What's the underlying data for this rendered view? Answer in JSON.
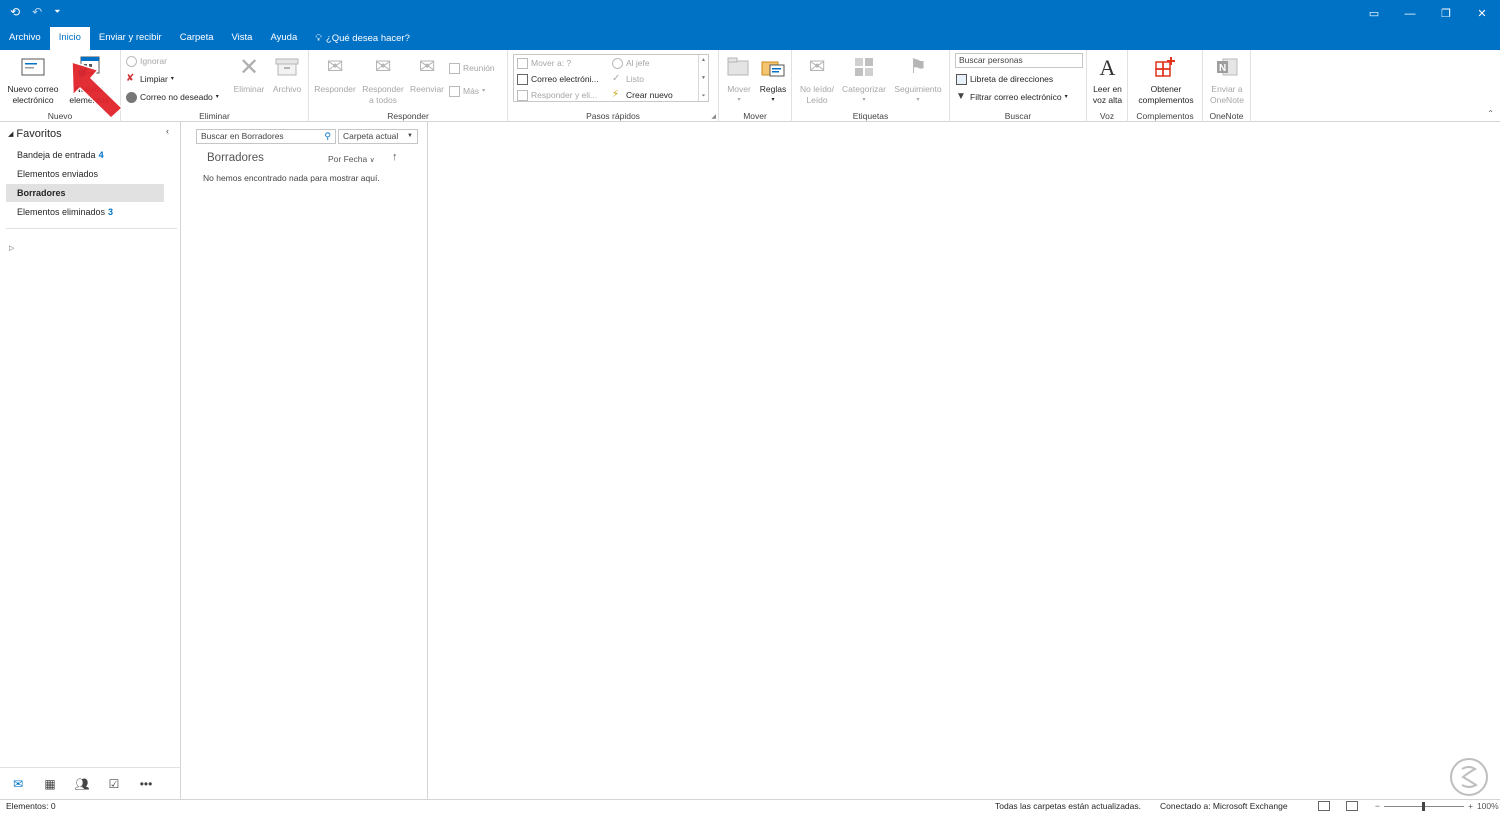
{
  "menubar": {
    "tabs": [
      "Archivo",
      "Inicio",
      "Enviar y recibir",
      "Carpeta",
      "Vista",
      "Ayuda"
    ],
    "tell_me": "¿Qué desea hacer?"
  },
  "ribbon": {
    "nuevo": {
      "new_email_1": "Nuevo correo",
      "new_email_2": "electrónico",
      "new_items_1": "Nuevos",
      "new_items_2": "elementos",
      "label": "Nuevo"
    },
    "eliminar": {
      "ignore": "Ignorar",
      "cleanup": "Limpiar",
      "junk": "Correo no deseado",
      "delete": "Eliminar",
      "archive": "Archivo",
      "label": "Eliminar"
    },
    "responder": {
      "reply": "Responder",
      "reply_all_1": "Responder",
      "reply_all_2": "a todos",
      "forward": "Reenviar",
      "meeting": "Reunión",
      "more": "Más",
      "label": "Responder"
    },
    "pasos": {
      "move_to": "Mover a: ?",
      "email": "Correo electróni...",
      "reply_delete": "Responder y eli...",
      "to_boss": "Al jefe",
      "done": "Listo",
      "create_new": "Crear nuevo",
      "label": "Pasos rápidos"
    },
    "mover": {
      "move": "Mover",
      "rules": "Reglas",
      "label": "Mover"
    },
    "etiquetas": {
      "unread_1": "No leído/",
      "unread_2": "Leído",
      "categorize": "Categorizar",
      "followup": "Seguimiento",
      "label": "Etiquetas"
    },
    "buscar": {
      "search_people": "Buscar personas",
      "address_book": "Libreta de direcciones",
      "filter": "Filtrar correo electrónico",
      "label": "Buscar"
    },
    "voz": {
      "read_1": "Leer en",
      "read_2": "voz alta",
      "label": "Voz"
    },
    "complementos": {
      "get_1": "Obtener",
      "get_2": "complementos",
      "label": "Complementos"
    },
    "onenote": {
      "send_1": "Enviar a",
      "send_2": "OneNote",
      "label": "OneNote"
    }
  },
  "folders": {
    "favorites_label": "Favoritos",
    "items": [
      {
        "name": "Bandeja de entrada",
        "count": "4"
      },
      {
        "name": "Elementos enviados",
        "count": ""
      },
      {
        "name": "Borradores",
        "count": ""
      },
      {
        "name": "Elementos eliminados",
        "count": "3"
      }
    ],
    "selected": "Borradores"
  },
  "list": {
    "search_placeholder": "Buscar en Borradores",
    "scope": "Carpeta actual",
    "folder_title": "Borradores",
    "sort_by": "Por Fecha",
    "empty": "No hemos encontrado nada para mostrar aquí."
  },
  "status": {
    "items": "Elementos: 0",
    "sync": "Todas las carpetas están actualizadas.",
    "connection": "Conectado a: Microsoft Exchange",
    "zoom": "100%"
  },
  "colors": {
    "accent": "#0072c6",
    "arrow": "#e0242b"
  }
}
